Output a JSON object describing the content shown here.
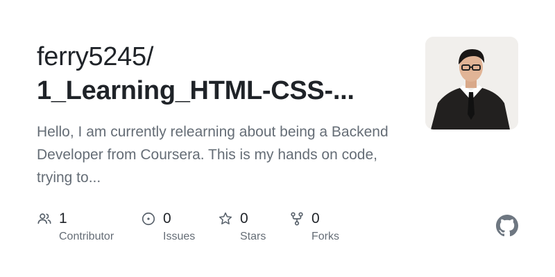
{
  "repo": {
    "owner": "ferry5245/",
    "name": "1_Learning_HTML-CSS-...",
    "description": "Hello, I am currently relearning about being a Backend Developer from Coursera. This is my hands on code, trying to..."
  },
  "stats": [
    {
      "icon": "people-icon",
      "count": "1",
      "label": "Contributor"
    },
    {
      "icon": "issue-icon",
      "count": "0",
      "label": "Issues"
    },
    {
      "icon": "star-icon",
      "count": "0",
      "label": "Stars"
    },
    {
      "icon": "fork-icon",
      "count": "0",
      "label": "Forks"
    }
  ],
  "colors": {
    "text": "#1f2328",
    "muted": "#656d76",
    "icon": "#57606a",
    "github": "#6e7781"
  },
  "brand_icon": "github-logo-icon"
}
